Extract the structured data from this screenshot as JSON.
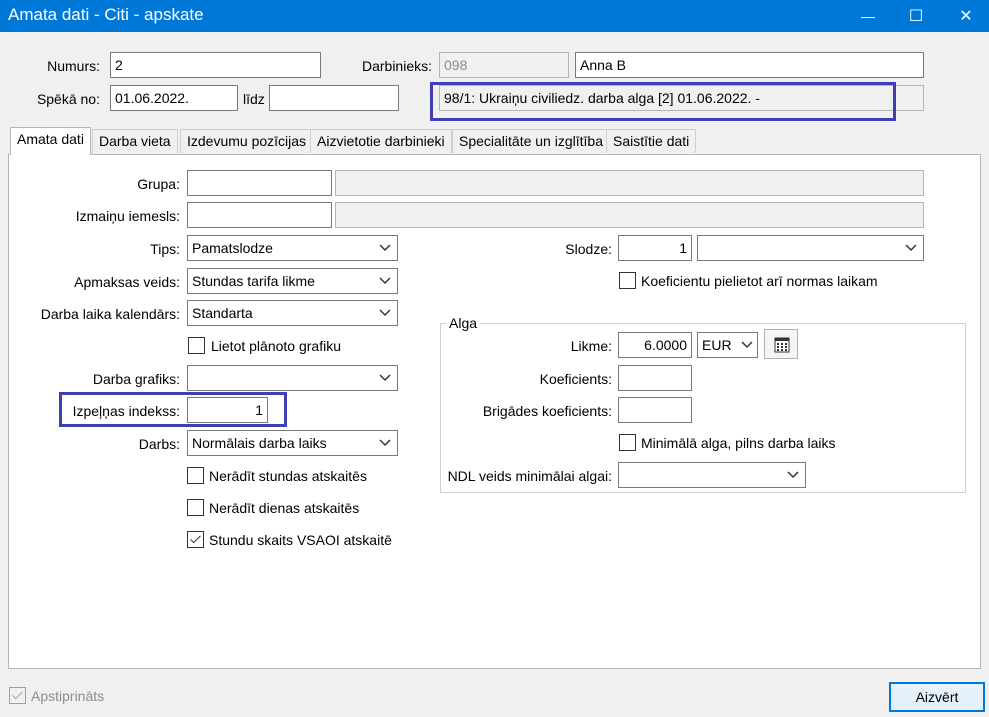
{
  "window": {
    "title": "Amata dati - Citi - apskate",
    "minimize_glyph": "—",
    "maximize_glyph": "☐",
    "close_glyph": "✕"
  },
  "header": {
    "numurs_label": "Numurs:",
    "numurs_value": "2",
    "darbinieks_label": "Darbinieks:",
    "darbinieks_code": "098",
    "darbinieks_name": "Anna B",
    "speka_no_label": "Spēkā no:",
    "speka_no_value": "01.06.2022.",
    "lidz_label": "līdz",
    "lidz_value": "",
    "description": "98/1: Ukraiņu civiliedz. darba alga [2] 01.06.2022. -"
  },
  "tabs": [
    {
      "label": "Amata dati",
      "active": true
    },
    {
      "label": "Darba vieta"
    },
    {
      "label": "Izdevumu pozīcijas"
    },
    {
      "label": "Aizvietotie darbinieki"
    },
    {
      "label": "Specialitāte un izglītība"
    },
    {
      "label": "Saistītie dati"
    }
  ],
  "form": {
    "grupa_label": "Grupa:",
    "grupa_code": "",
    "grupa_name": "",
    "izmainu_label": "Izmaiņu iemesls:",
    "izmainu_code": "",
    "izmainu_name": "",
    "tips_label": "Tips:",
    "tips_value": "Pamatslodze",
    "apmaksas_label": "Apmaksas veids:",
    "apmaksas_value": "Stundas tarifa likme",
    "kalendars_label": "Darba laika kalendārs:",
    "kalendars_value": "Standarta",
    "lietot_grafiku_label": "Lietot plānoto grafiku",
    "lietot_grafiku_checked": false,
    "grafiks_label": "Darba grafiks:",
    "grafiks_value": "",
    "izpelnas_label": "Izpeļņas indekss:",
    "izpelnas_value": "1",
    "darbs_label": "Darbs:",
    "darbs_value": "Normālais darba laiks",
    "nerādīt_stundas_label": "Nerādīt stundas atskaitēs",
    "nerādīt_stundas_checked": false,
    "nerādīt_dienas_label": "Nerādīt dienas atskaitēs",
    "nerādīt_dienas_checked": false,
    "vsaoi_label": "Stundu skaits VSAOI atskaitē",
    "vsaoi_checked": true,
    "slodze_label": "Slodze:",
    "slodze_value": "1",
    "slodze_unit": "",
    "koef_norm_label": "Koeficientu pielietot arī normas laikam",
    "koef_norm_checked": false
  },
  "alga": {
    "group_title": "Alga",
    "likme_label": "Likme:",
    "likme_value": "6.0000",
    "currency": "EUR",
    "koeficients_label": "Koeficients:",
    "koeficients_value": "",
    "brigades_label": "Brigādes koeficients:",
    "brigades_value": "",
    "min_alga_label": "Minimālā alga, pilns darba laiks",
    "min_alga_checked": false,
    "ndl_label": "NDL veids minimālai algai:",
    "ndl_value": ""
  },
  "footer": {
    "apstiprinats_label": "Apstiprināts",
    "apstiprinats_checked": true,
    "close_button": "Aizvērt"
  },
  "colors": {
    "titlebar": "#0078d7",
    "highlight": "#3f3fb5"
  }
}
